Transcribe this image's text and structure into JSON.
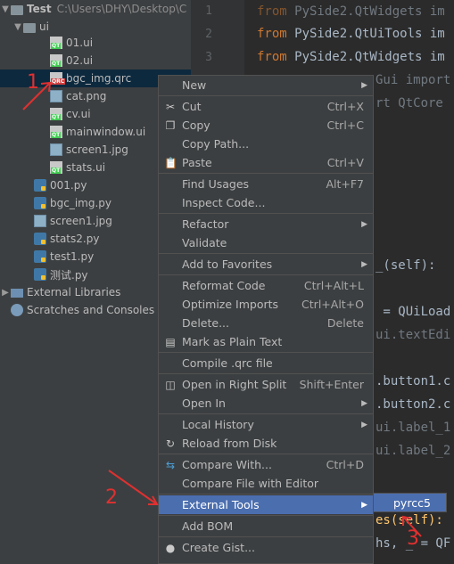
{
  "project": {
    "root_name": "Test",
    "root_path": "C:\\Users\\DHY\\Desktop\\C",
    "items": [
      {
        "label": "ui",
        "kind": "folder"
      },
      {
        "label": "01.ui",
        "kind": "qt"
      },
      {
        "label": "02.ui",
        "kind": "qt"
      },
      {
        "label": "bgc_img.qrc",
        "kind": "qrc"
      },
      {
        "label": "cat.png",
        "kind": "img"
      },
      {
        "label": "cv.ui",
        "kind": "qt"
      },
      {
        "label": "mainwindow.ui",
        "kind": "qt"
      },
      {
        "label": "screen1.jpg",
        "kind": "img"
      },
      {
        "label": "stats.ui",
        "kind": "qt"
      },
      {
        "label": "001.py",
        "kind": "py"
      },
      {
        "label": "bgc_img.py",
        "kind": "py"
      },
      {
        "label": "screen1.jpg",
        "kind": "img"
      },
      {
        "label": "stats2.py",
        "kind": "py"
      },
      {
        "label": "test1.py",
        "kind": "py"
      },
      {
        "label": "测试.py",
        "kind": "py"
      },
      {
        "label": "External Libraries",
        "kind": "lib"
      },
      {
        "label": "Scratches and Consoles",
        "kind": "scratch"
      }
    ]
  },
  "editor": {
    "line_numbers": [
      "1",
      "2",
      "3"
    ],
    "lines": [
      {
        "kw": "from",
        "rest": " PySide2.QtWidgets im"
      },
      {
        "kw": "from",
        "rest": " PySide2.QtUiTools im"
      },
      {
        "kw": "from",
        "rest": " PySide2.QtWidgets im"
      },
      {
        "kw": "",
        "rest": "Gui import"
      },
      {
        "kw": "",
        "rest": "rt QtCore"
      },
      {
        "kw": "",
        "rest": "_(self):"
      },
      {
        "kw": "",
        "rest": " = QUiLoad"
      },
      {
        "kw": "",
        "rest": "ui.textEdi"
      },
      {
        "kw": "",
        "rest": ".button1.c"
      },
      {
        "kw": "",
        "rest": ".button2.c"
      },
      {
        "kw": "",
        "rest": "ui.label_1"
      },
      {
        "kw": "",
        "rest": "ui.label_2"
      },
      {
        "kw": "",
        "rest": "es(self):"
      },
      {
        "kw": "",
        "rest": "hs, _ = QF"
      }
    ]
  },
  "context_menu": {
    "items": [
      {
        "label": "New",
        "shortcut": "",
        "submenu": true,
        "icon": ""
      },
      {
        "label": "Cut",
        "shortcut": "Ctrl+X",
        "icon": "scissors-icon"
      },
      {
        "label": "Copy",
        "shortcut": "Ctrl+C",
        "icon": "copy-icon"
      },
      {
        "label": "Copy Path...",
        "shortcut": "",
        "icon": ""
      },
      {
        "label": "Paste",
        "shortcut": "Ctrl+V",
        "icon": "clipboard-icon"
      },
      {
        "label": "Find Usages",
        "shortcut": "Alt+F7",
        "icon": ""
      },
      {
        "label": "Inspect Code...",
        "shortcut": "",
        "icon": ""
      },
      {
        "label": "Refactor",
        "shortcut": "",
        "submenu": true,
        "icon": ""
      },
      {
        "label": "Validate",
        "shortcut": "",
        "icon": ""
      },
      {
        "label": "Add to Favorites",
        "shortcut": "",
        "submenu": true,
        "icon": ""
      },
      {
        "label": "Reformat Code",
        "shortcut": "Ctrl+Alt+L",
        "icon": ""
      },
      {
        "label": "Optimize Imports",
        "shortcut": "Ctrl+Alt+O",
        "icon": ""
      },
      {
        "label": "Delete...",
        "shortcut": "Delete",
        "icon": ""
      },
      {
        "label": "Mark as Plain Text",
        "shortcut": "",
        "icon": "plain-text-icon"
      },
      {
        "label": "Compile .qrc file",
        "shortcut": "",
        "icon": ""
      },
      {
        "label": "Open in Right Split",
        "shortcut": "Shift+Enter",
        "icon": "split-icon"
      },
      {
        "label": "Open In",
        "shortcut": "",
        "submenu": true,
        "icon": ""
      },
      {
        "label": "Local History",
        "shortcut": "",
        "submenu": true,
        "icon": ""
      },
      {
        "label": "Reload from Disk",
        "shortcut": "",
        "icon": "reload-icon"
      },
      {
        "label": "Compare With...",
        "shortcut": "Ctrl+D",
        "icon": "compare-icon"
      },
      {
        "label": "Compare File with Editor",
        "shortcut": "",
        "icon": ""
      },
      {
        "label": "External Tools",
        "shortcut": "",
        "submenu": true,
        "icon": "",
        "highlighted": true
      },
      {
        "label": "Add BOM",
        "shortcut": "",
        "icon": ""
      },
      {
        "label": "Create Gist...",
        "shortcut": "",
        "icon": "github-icon"
      }
    ]
  },
  "submenu": {
    "label": "pyrcc5"
  },
  "annotations": {
    "n1": "1",
    "n2": "2",
    "n3": "3",
    "color": "#e03030"
  }
}
